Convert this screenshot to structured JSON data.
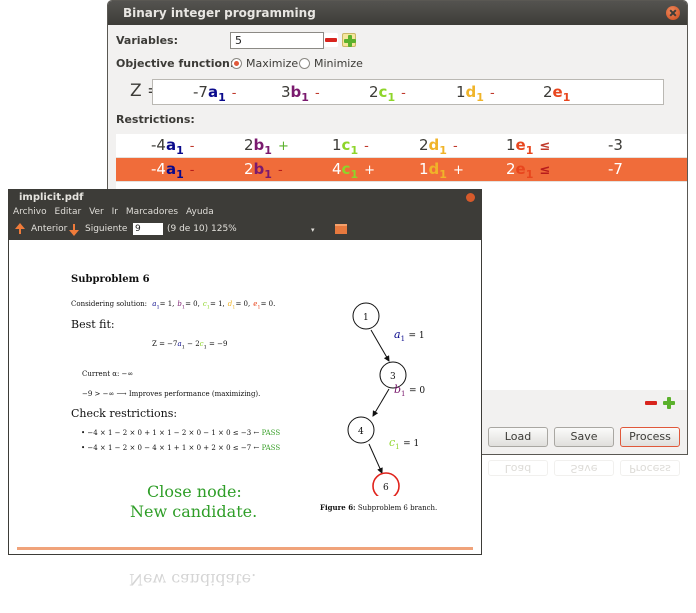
{
  "bip": {
    "title": "Binary integer programming",
    "variables_label": "Variables:",
    "variables_value": "5",
    "objective_label": "Objective function:",
    "maximize_label": "Maximize",
    "minimize_label": "Minimize",
    "selected_sense": "Maximize",
    "z_label": "Z =",
    "objective_terms": [
      {
        "coef": "-7",
        "var": "a",
        "sub": "1",
        "op": "-",
        "color": "#0a0a8c"
      },
      {
        "coef": "3",
        "var": "b",
        "sub": "1",
        "op": "-",
        "color": "#7a1a6e"
      },
      {
        "coef": "2",
        "var": "c",
        "sub": "1",
        "op": "-",
        "color": "#8ed52a"
      },
      {
        "coef": "1",
        "var": "d",
        "sub": "1",
        "op": "-",
        "color": "#f0b429"
      },
      {
        "coef": "2",
        "var": "e",
        "sub": "1",
        "op": "",
        "color": "#e8461e"
      }
    ],
    "restrictions_label": "Restrictions:",
    "restrictions": [
      {
        "terms": [
          {
            "coef": "-4",
            "var": "a",
            "sub": "1",
            "op": "-"
          },
          {
            "coef": "2",
            "var": "b",
            "sub": "1",
            "op": "+"
          },
          {
            "coef": "1",
            "var": "c",
            "sub": "1",
            "op": "-"
          },
          {
            "coef": "2",
            "var": "d",
            "sub": "1",
            "op": "-"
          },
          {
            "coef": "1",
            "var": "e",
            "sub": "1",
            "op": "≤"
          }
        ],
        "rhs": "-3",
        "selected": false
      },
      {
        "terms": [
          {
            "coef": "-4",
            "var": "a",
            "sub": "1",
            "op": "-"
          },
          {
            "coef": "2",
            "var": "b",
            "sub": "1",
            "op": "-"
          },
          {
            "coef": "4",
            "var": "c",
            "sub": "1",
            "op": "+"
          },
          {
            "coef": "1",
            "var": "d",
            "sub": "1",
            "op": "+"
          },
          {
            "coef": "2",
            "var": "e",
            "sub": "1",
            "op": "≤"
          }
        ],
        "rhs": "-7",
        "selected": true
      }
    ],
    "buttons": {
      "load": "Load",
      "save": "Save",
      "process": "Process"
    }
  },
  "pdf": {
    "title": "implicit.pdf",
    "menu": [
      "Archivo",
      "Editar",
      "Ver",
      "Ir",
      "Marcadores",
      "Ayuda"
    ],
    "toolbar": {
      "prev": "Anterior",
      "next": "Siguiente",
      "page": "9",
      "page_info": "(9 de 10)",
      "zoom": "125%"
    },
    "content": {
      "heading": "Subproblem 6",
      "considering_prefix": "Considering solution:",
      "solution": [
        {
          "var": "a",
          "sub": "1",
          "val": "= 1,",
          "color": "#0a0a8c"
        },
        {
          "var": "b",
          "sub": "1",
          "val": "= 0,",
          "color": "#7a1a6e"
        },
        {
          "var": "c",
          "sub": "1",
          "val": "= 1,",
          "color": "#8ed52a"
        },
        {
          "var": "d",
          "sub": "1",
          "val": "= 0,",
          "color": "#f0b429"
        },
        {
          "var": "e",
          "sub": "1",
          "val": "= 0.",
          "color": "#e8461e"
        }
      ],
      "best_fit_label": "Best fit:",
      "z_eq_prefix": "Z = −7",
      "z_eq_mid": " − 2",
      "z_eq_result": " = −9",
      "current_label": "Current α: −∞",
      "improves_text": "−9 > −∞ ⟶ Improves performance (maximizing).",
      "check_label": "Check restrictions:",
      "check_items": [
        {
          "expr": "−4 × 1 − 2 × 0 + 1 × 1 − 2 × 0 − 1 × 0 ≤ −3 ←",
          "result": "PASS"
        },
        {
          "expr": "−4 × 1 − 2 × 0 − 4 × 1 + 1 × 0 + 2 × 0 ≤ −7 ←",
          "result": "PASS"
        }
      ],
      "close_node_1": "Close node:",
      "close_node_2": "New candidate.",
      "figure_caption_bold": "Figure 6:",
      "figure_caption": " Subproblem 6 branch.",
      "tree": {
        "nodes": [
          "1",
          "3",
          "4",
          "6"
        ],
        "edge_labels": [
          {
            "var": "a",
            "sub": "1",
            "val": "= 1",
            "color": "#0a0a8c"
          },
          {
            "var": "b",
            "sub": "1",
            "val": "= 0",
            "color": "#7a1a6e"
          },
          {
            "var": "c",
            "sub": "1",
            "val": "= 1",
            "color": "#8ed52a"
          }
        ]
      }
    }
  },
  "colors": {
    "accent": "#f06c3a",
    "title_bar": "#3d3c38",
    "pass": "#3aa02a"
  }
}
